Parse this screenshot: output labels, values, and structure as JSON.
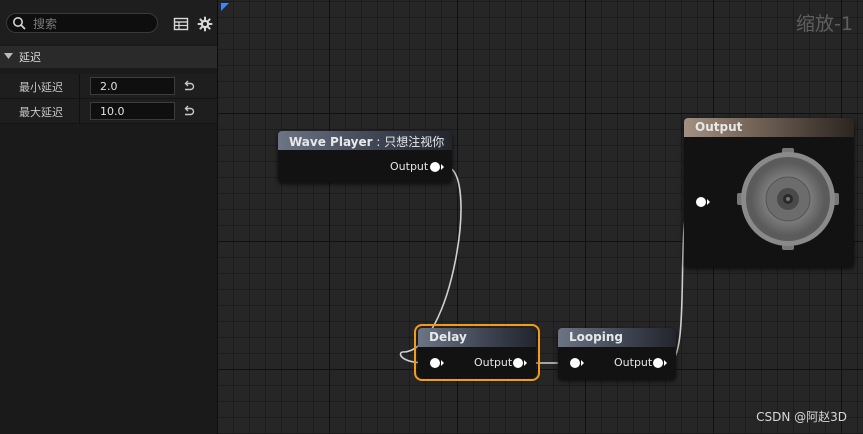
{
  "details": {
    "search": {
      "placeholder": "搜索",
      "value": ""
    },
    "category": "延迟",
    "properties": [
      {
        "label": "最小延迟",
        "value": "2.0"
      },
      {
        "label": "最大延迟",
        "value": "10.0"
      }
    ]
  },
  "graph": {
    "zoom": "缩放-1",
    "nodes": {
      "wave_player": {
        "title": "Wave Player",
        "subtitle": " : 只想注视你",
        "output": "Output"
      },
      "delay": {
        "title": "Delay",
        "output": "Output",
        "selected": true
      },
      "looping": {
        "title": "Looping",
        "output": "Output"
      },
      "output": {
        "title": "Output"
      }
    }
  },
  "watermark": "CSDN @阿赵3D",
  "colors": {
    "selection_outline": "#f39c1a",
    "corner_mark": "#3a86ff",
    "wire": "#cfcfcf"
  }
}
